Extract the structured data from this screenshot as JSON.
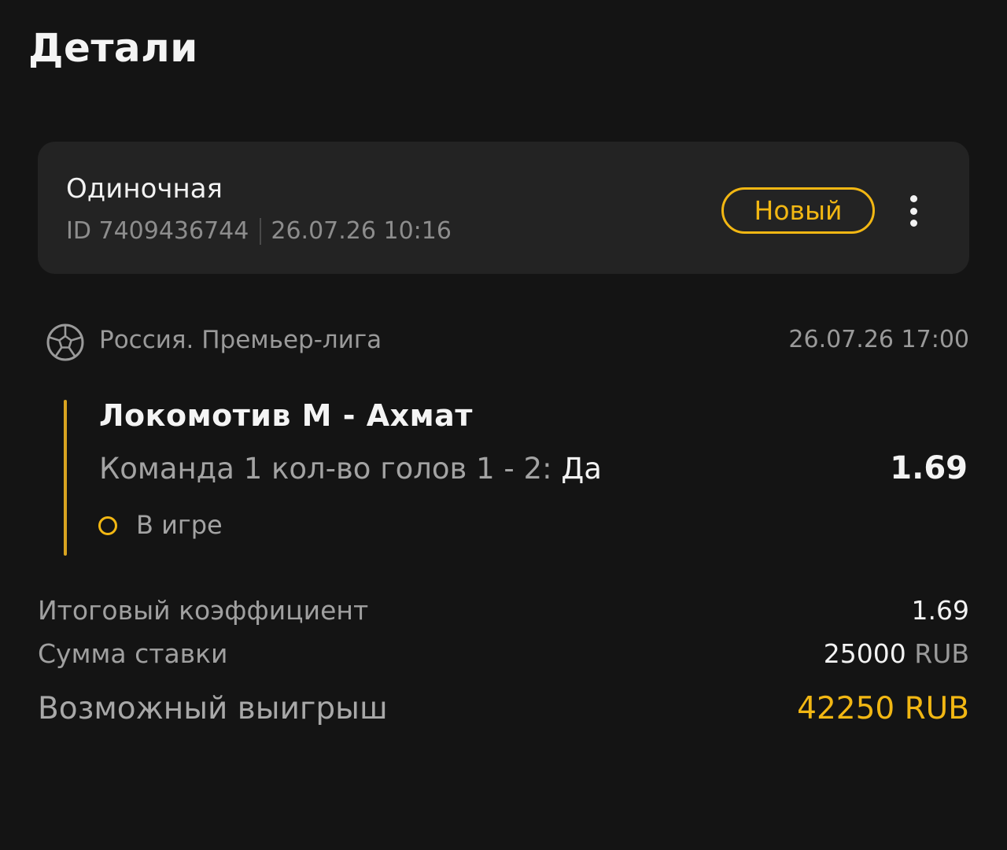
{
  "header": {
    "title": "Детали"
  },
  "bet": {
    "type": "Одиночная",
    "id": "ID 7409436744",
    "created": "26.07.26 10:16",
    "status": "Новый",
    "more_icon": "more-vertical-icon"
  },
  "event": {
    "sport_icon": "soccer-ball-icon",
    "league": "Россия. Премьер-лига",
    "datetime": "26.07.26 17:00",
    "match": "Локомотив М - Ахмат",
    "outcome_label": "Команда 1 кол-во голов 1 - 2:",
    "outcome_value": "Да",
    "odds": "1.69",
    "state": "В игре"
  },
  "summary": {
    "total_odds_label": "Итоговый коэффициент",
    "total_odds_value": "1.69",
    "stake_label": "Сумма ставки",
    "stake_amount": "25000",
    "stake_currency": "RUB",
    "win_label": "Возможный выигрыш",
    "win_value": "42250 RUB"
  },
  "colors": {
    "background": "#141414",
    "card": "#232323",
    "accent": "#f2b713",
    "muted_text": "#9a9a9a"
  }
}
